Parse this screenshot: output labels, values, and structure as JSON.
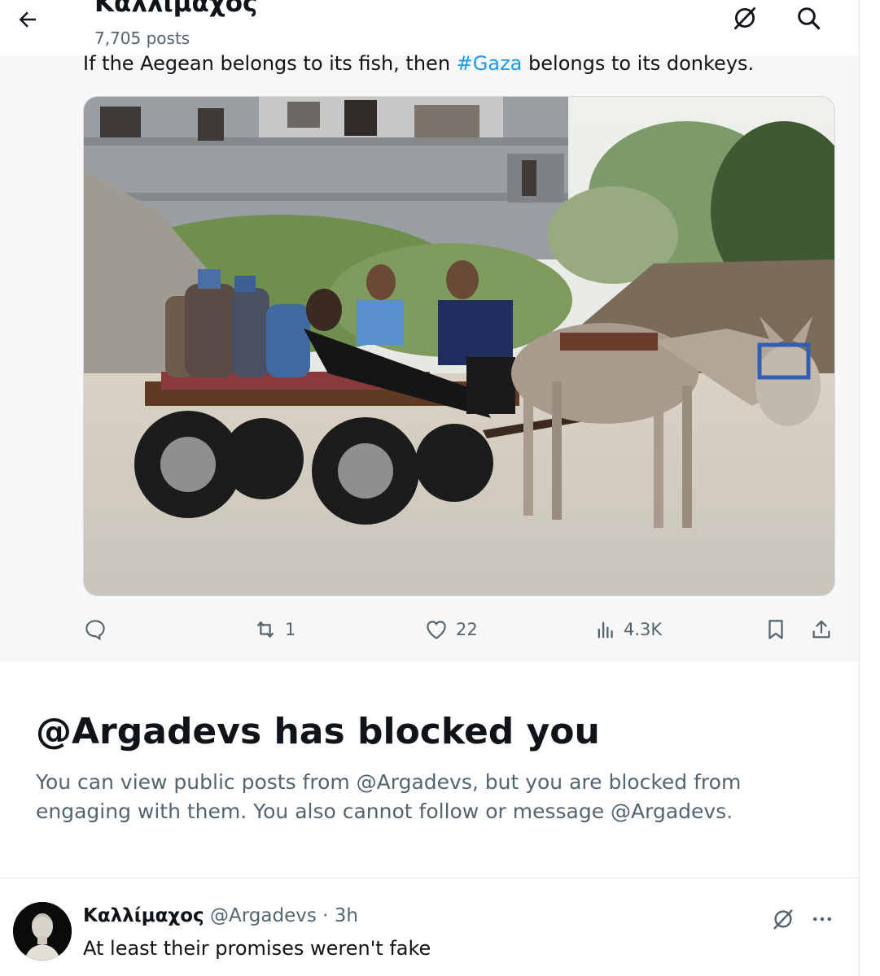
{
  "header": {
    "title": "Καλλίμαχος",
    "post_count": "7,705 posts",
    "back_icon": "arrow-left-icon",
    "icons": [
      "grok-icon",
      "search-icon"
    ]
  },
  "tweet": {
    "text_before": "If the Aegean belongs to its fish, then ",
    "hashtag": "#Gaza",
    "text_after": " belongs to its donkeys.",
    "photo_alt": "Children riding a donkey cart loaded with gas cylinders",
    "stats": {
      "replies": "",
      "reposts": "1",
      "likes": "22",
      "views": "4.3K"
    }
  },
  "blocked": {
    "title": "@Argadevs has blocked you",
    "description": "You can view public posts from @Argadevs, but you are blocked from engaging with them. You also cannot follow or message @Argadevs."
  },
  "reply": {
    "name": "Καλλίμαχος",
    "handle": "@Argadevs",
    "separator": "·",
    "time": "3h",
    "text": "At least their promises weren't fake"
  },
  "colors": {
    "accent": "#1d9bf0",
    "text_primary": "#0f1419",
    "text_secondary": "#536471",
    "background_muted": "#f7f7f7"
  }
}
